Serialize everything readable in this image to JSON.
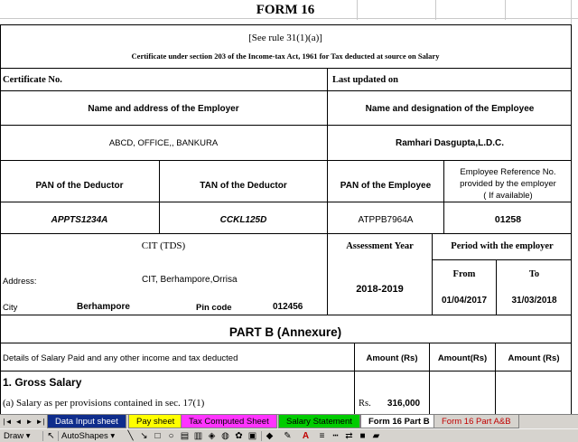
{
  "form": {
    "title": "FORM 16",
    "rule": "[See rule 31(1)(a)]",
    "certificate_text": "Certificate under section 203 of the Income-tax Act, 1961 for Tax deducted at source on Salary",
    "certificate_no_label": "Certificate No.",
    "last_updated_label": "Last updated on",
    "employer_header": "Name and address of the Employer",
    "employee_header": "Name and designation of the Employee",
    "employer_value": "ABCD, OFFICE,, BANKURA",
    "employee_value": "Ramhari Dasgupta,L.D.C.",
    "pan_deductor_label": "PAN of the Deductor",
    "tan_deductor_label": "TAN of the Deductor",
    "pan_employee_label": "PAN of the Employee",
    "emp_ref_label_1": "Employee Reference No.",
    "emp_ref_label_2": "provided by the employer",
    "emp_ref_label_3": "( If available)",
    "pan_deductor_value": "APPTS1234A",
    "tan_deductor_value": "CCKL125D",
    "pan_employee_value": "ATPPB7964A",
    "emp_ref_value": "01258",
    "cit_label": "CIT (TDS)",
    "assessment_year_label": "Assessment Year",
    "period_label": "Period with the employer",
    "from_label": "From",
    "to_label": "To",
    "address_label": "Address:",
    "address_value": "CIT, Berhampore,Orrisa",
    "city_label": "City",
    "city_value": "Berhampore",
    "pin_label": "Pin code",
    "pin_value": "012456",
    "assessment_year_value": "2018-2019",
    "from_value": "01/04/2017",
    "to_value": "31/03/2018",
    "part_b_title": "PART B (Annexure)",
    "details_label": "Details of Salary Paid and any other income and tax deducted",
    "amount_col_1": "Amount (Rs)",
    "amount_col_2": "Amount(Rs)",
    "amount_col_3": "Amount (Rs)",
    "gross_salary_label": "1.  Gross Salary",
    "salary_171_label": "(a) Salary as per provisions contained in sec. 17(1)",
    "rs_label": "Rs.",
    "salary_171_value": "316,000"
  },
  "sheet_tabs": {
    "nav_first": "|◄",
    "nav_prev": "◄",
    "nav_next": "►",
    "nav_last": "►|",
    "tabs": [
      {
        "label": "Data Input sheet",
        "color": "#0f2d8c",
        "text_color": "#ffffff"
      },
      {
        "label": "Pay sheet",
        "color": "#ffff00",
        "text_color": "#000000"
      },
      {
        "label": "Tax Computed Sheet",
        "color": "#ff33ff",
        "text_color": "#000000"
      },
      {
        "label": "Salary Statement",
        "color": "#00cc00",
        "text_color": "#000000"
      },
      {
        "label": "Form 16 Part B",
        "color": "#ffffff",
        "text_color": "#000000",
        "active": true
      },
      {
        "label": "Form 16 Part A&B",
        "color": "#d6d3ce",
        "text_color": "#c00000"
      }
    ]
  },
  "drawing_toolbar": {
    "draw_label": "Draw ▾",
    "autoshapes_label": "AutoShapes ▾",
    "font_color_glyph": "A"
  },
  "colors": {
    "grid": "#c9c9c9",
    "toolbar_bg": "#d6d3ce"
  }
}
